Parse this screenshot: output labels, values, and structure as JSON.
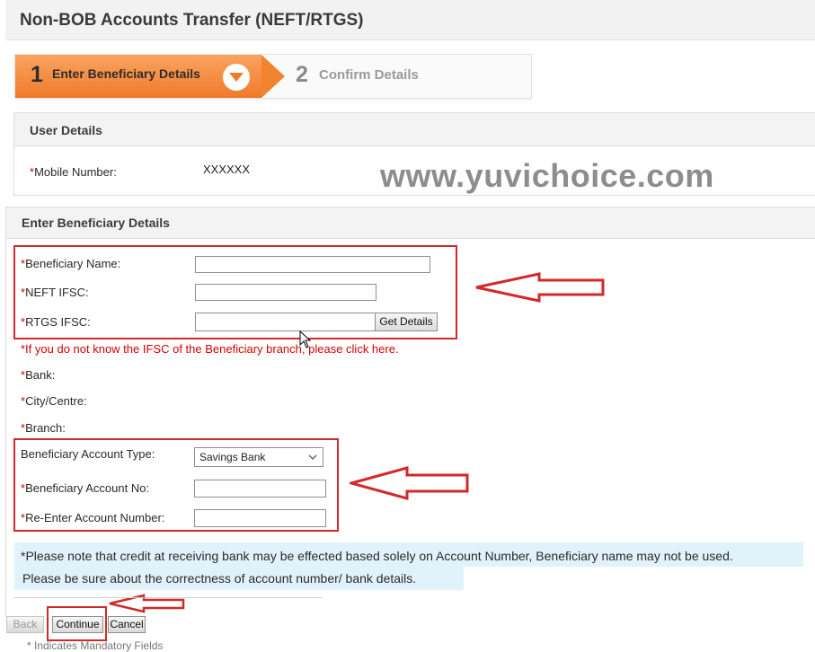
{
  "title": "Non-BOB Accounts Transfer (NEFT/RTGS)",
  "stepper": {
    "step1": {
      "number": "1",
      "label": "Enter Beneficiary Details"
    },
    "step2": {
      "number": "2",
      "label": "Confirm Details"
    }
  },
  "user_details": {
    "heading": "User Details",
    "mobile_label": "Mobile Number:",
    "mobile_value": "XXXXXX"
  },
  "watermark": "www.yuvichoice.com",
  "required_marker": "*",
  "beneficiary": {
    "heading": "Enter Beneficiary Details",
    "name_label": "Beneficiary Name:",
    "neft_label": "NEFT IFSC:",
    "rtgs_label": "RTGS IFSC:",
    "get_details_label": "Get Details",
    "ifsc_help": "*If you do not know the IFSC of the Beneficiary branch, please click here.",
    "bank_label": "Bank:",
    "city_label": "City/Centre:",
    "branch_label": "Branch:",
    "account_type_label": "Beneficiary Account Type:",
    "account_type_value": "Savings Bank",
    "account_no_label": "Beneficiary Account No:",
    "reenter_label": "Re-Enter Account Number:"
  },
  "note": {
    "line1": "*Please note that credit at receiving bank may be effected based solely on Account Number, Beneficiary name may not be used.",
    "line2": "Please be sure about the correctness of account number/ bank details."
  },
  "buttons": {
    "back": "Back",
    "continue": "Continue",
    "cancel": "Cancel"
  },
  "mandatory_note": "* Indicates Mandatory Fields",
  "colors": {
    "accent_orange": "#f07a2c",
    "highlight_red": "#d12a2a",
    "required_red": "#d40000",
    "note_bg": "#e0f2fa"
  }
}
